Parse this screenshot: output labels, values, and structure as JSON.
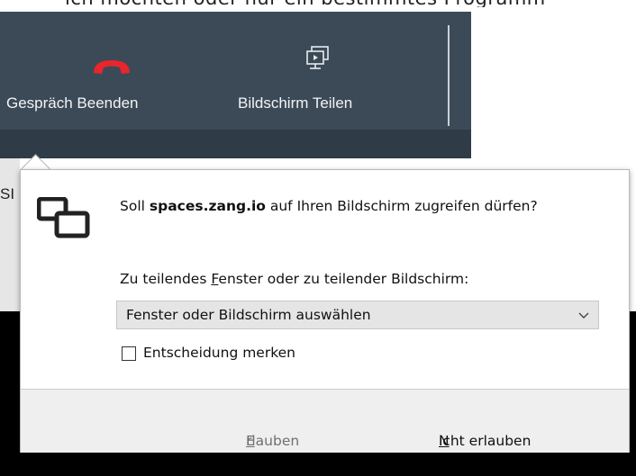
{
  "background_text": "ich möchten oder nur ein bestimmtes Programm",
  "left_partial_text": "SI",
  "toolbar": {
    "end_call_label": "Gespräch Beenden",
    "share_screen_label": "Bildschirm Teilen",
    "end_call_icon": "phone-hangup-icon",
    "share_screen_icon": "screen-share-icon",
    "end_call_color": "#e8262b"
  },
  "dialog": {
    "prompt_prefix": "Soll ",
    "prompt_domain": "spaces.zang.io",
    "prompt_suffix": " auf Ihren Bildschirm zugreifen dürfen?",
    "share_label_pre": "Zu teilendes ",
    "share_label_accel": "F",
    "share_label_post": "enster oder zu teilender Bildschirm:",
    "select_value": "Fenster oder Bildschirm auswählen",
    "remember_label": "Entscheidung merken",
    "remember_checked": false,
    "allow_accel": "E",
    "allow_rest": "rlauben",
    "deny_accel": "N",
    "deny_rest": "icht erlauben",
    "icon": "screen-sharing-icon"
  }
}
